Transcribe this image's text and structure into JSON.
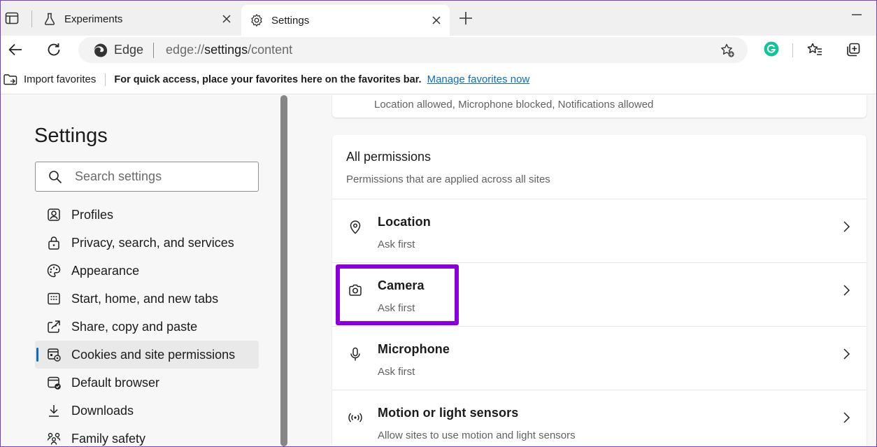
{
  "tabs": [
    {
      "label": "Experiments",
      "icon": "flask-icon",
      "active": false
    },
    {
      "label": "Settings",
      "icon": "gear-icon",
      "active": true
    }
  ],
  "address_bar": {
    "site_name": "Edge",
    "url_prefix": "edge://",
    "url_path": "settings",
    "url_suffix": "/content"
  },
  "favorites_bar": {
    "import_label": "Import favorites",
    "message": "For quick access, place your favorites here on the favorites bar.",
    "manage_link": "Manage favorites now"
  },
  "sidebar": {
    "title": "Settings",
    "search_placeholder": "Search settings",
    "items": [
      {
        "label": "Profiles",
        "icon": "profile-icon"
      },
      {
        "label": "Privacy, search, and services",
        "icon": "lock-icon"
      },
      {
        "label": "Appearance",
        "icon": "palette-icon"
      },
      {
        "label": "Start, home, and new tabs",
        "icon": "home-tabs-icon"
      },
      {
        "label": "Share, copy and paste",
        "icon": "share-icon"
      },
      {
        "label": "Cookies and site permissions",
        "icon": "cookies-icon",
        "active": true
      },
      {
        "label": "Default browser",
        "icon": "browser-icon"
      },
      {
        "label": "Downloads",
        "icon": "download-icon"
      },
      {
        "label": "Family safety",
        "icon": "family-icon"
      }
    ]
  },
  "content": {
    "previous_card_subtitle": "Location allowed, Microphone blocked, Notifications allowed",
    "all_permissions": {
      "heading": "All permissions",
      "description": "Permissions that are applied across all sites",
      "rows": [
        {
          "title": "Location",
          "status": "Ask first",
          "icon": "location-pin-icon"
        },
        {
          "title": "Camera",
          "status": "Ask first",
          "icon": "camera-icon",
          "highlighted": true
        },
        {
          "title": "Microphone",
          "status": "Ask first",
          "icon": "microphone-icon"
        },
        {
          "title": "Motion or light sensors",
          "status": "Allow sites to use motion and light sensors",
          "icon": "sensors-icon"
        }
      ]
    }
  },
  "colors": {
    "accent": "#0f6cbd",
    "highlight": "#8a00d4",
    "grammarly": "#15c39a"
  }
}
